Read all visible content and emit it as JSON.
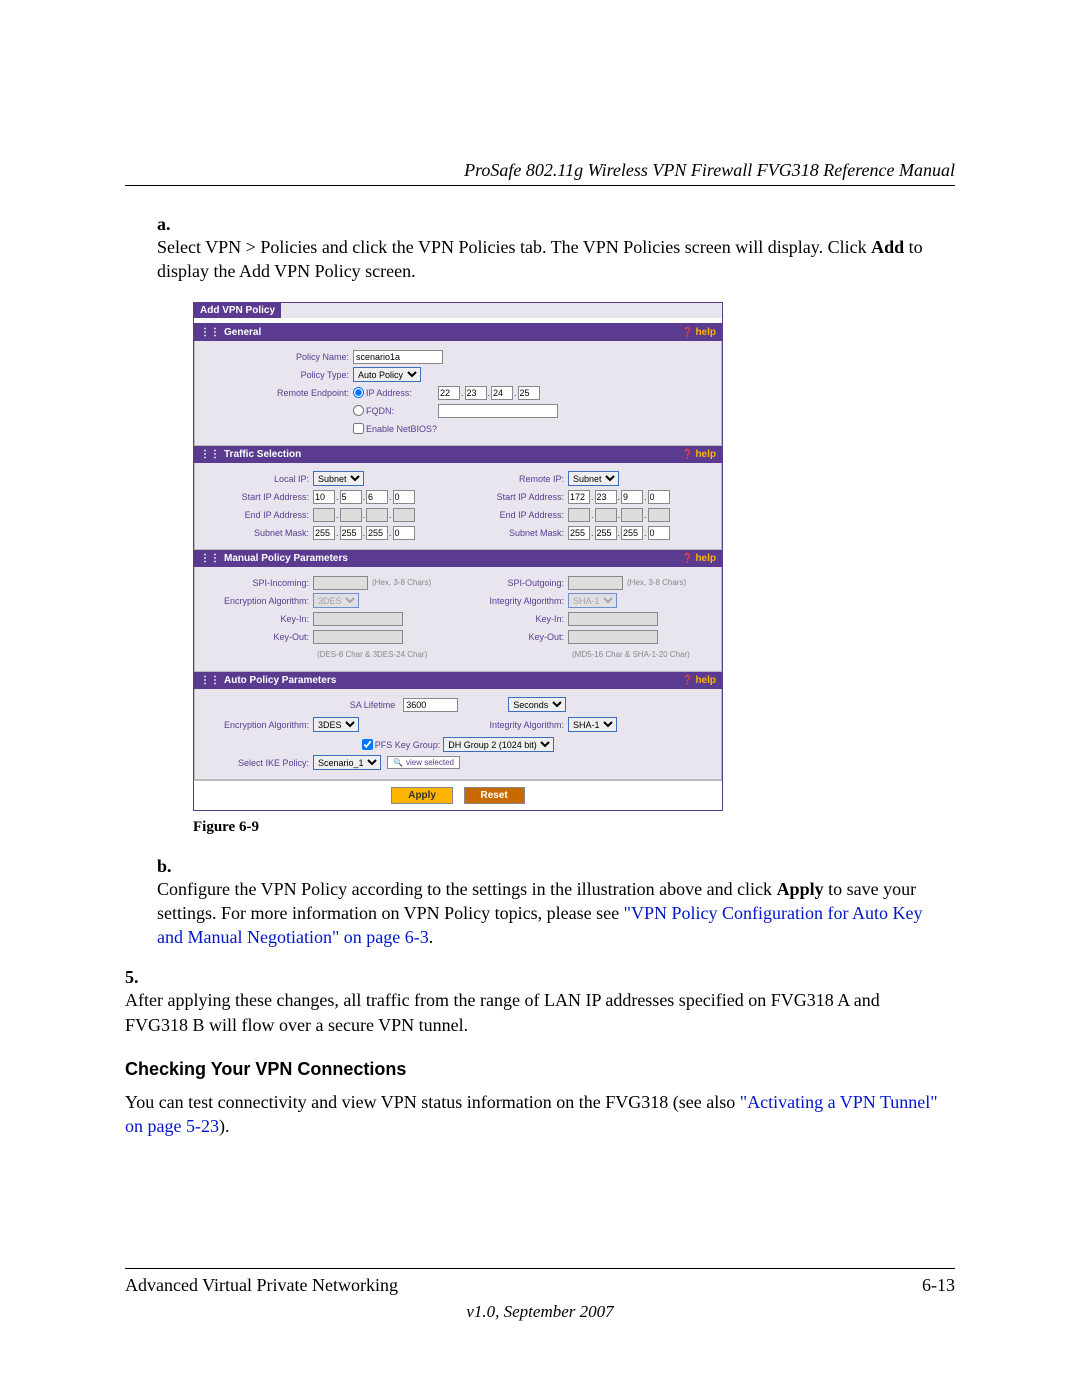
{
  "header_title": "ProSafe 802.11g Wireless VPN Firewall FVG318 Reference Manual",
  "step_a": {
    "label": "a.",
    "text_before": "Select VPN > Policies and click the VPN Policies tab. The VPN Policies screen will display. Click ",
    "bold": "Add",
    "text_after": " to display the Add VPN Policy screen."
  },
  "figure_caption": "Figure 6-9",
  "step_b": {
    "label": "b.",
    "text_before": "Configure the VPN Policy according to the settings in the illustration above and click ",
    "bold": "Apply",
    "text_mid": " to save your settings. For more information on VPN Policy topics, please see ",
    "link": "\"VPN Policy Configuration for Auto Key and Manual Negotiation\" on page 6-3",
    "text_after": "."
  },
  "step_5": {
    "label": "5.",
    "text": "After applying these changes, all traffic from the range of LAN IP addresses specified on FVG318 A and FVG318 B will flow over a secure VPN tunnel."
  },
  "subhead": "Checking Your VPN Connections",
  "body_para": {
    "text_before": "You can test connectivity and view VPN status information on the FVG318 (see also ",
    "link": "\"Activating a VPN Tunnel\" on page 5-23",
    "text_after": ")."
  },
  "footer_left": "Advanced Virtual Private Networking",
  "footer_right": "6-13",
  "footer_version": "v1.0, September 2007",
  "shot": {
    "tab": "Add VPN Policy",
    "help": "help",
    "general": {
      "title": "General",
      "policy_name_label": "Policy Name:",
      "policy_name_value": "scenario1a",
      "policy_type_label": "Policy Type:",
      "policy_type_value": "Auto Policy",
      "remote_endpoint_label": "Remote Endpoint:",
      "ip_label": "IP Address:",
      "ip": [
        "22",
        "23",
        "24",
        "25"
      ],
      "fqdn_label": "FQDN:",
      "netbios_label": "Enable NetBIOS?"
    },
    "traffic": {
      "title": "Traffic Selection",
      "local_ip_label": "Local IP:",
      "local_ip_value": "Subnet",
      "remote_ip_label": "Remote IP:",
      "remote_ip_value": "Subnet",
      "start_ip_label": "Start IP Address:",
      "local_start": [
        "10",
        "5",
        "6",
        "0"
      ],
      "remote_start": [
        "172",
        "23",
        "9",
        "0"
      ],
      "end_ip_label": "End IP Address:",
      "mask_label": "Subnet Mask:",
      "local_mask": [
        "255",
        "255",
        "255",
        "0"
      ],
      "remote_mask": [
        "255",
        "255",
        "255",
        "0"
      ]
    },
    "manual": {
      "title": "Manual Policy Parameters",
      "spi_in_label": "SPI-Incoming:",
      "spi_out_label": "SPI-Outgoing:",
      "hex_hint": "(Hex, 3-8 Chars)",
      "enc_label": "Encryption Algorithm:",
      "enc_value": "3DES",
      "int_label": "Integrity Algorithm:",
      "int_value": "SHA-1",
      "keyin_label": "Key-In:",
      "keyout_label": "Key-Out:",
      "enc_note": "(DES-8 Char & 3DES-24 Char)",
      "int_note": "(MD5-16 Char & SHA-1-20 Char)"
    },
    "auto": {
      "title": "Auto Policy Parameters",
      "sa_label": "SA Lifetime",
      "sa_value": "3600",
      "sa_unit": "Seconds",
      "enc_label": "Encryption Algorithm:",
      "enc_value": "3DES",
      "int_label": "Integrity Algorithm:",
      "int_value": "SHA-1",
      "pfs_label": "PFS Key Group:",
      "pfs_value": "DH Group 2 (1024 bit)",
      "ike_label": "Select IKE Policy:",
      "ike_value": "Scenario_1",
      "view_selected": "view selected"
    },
    "apply": "Apply",
    "reset": "Reset"
  }
}
